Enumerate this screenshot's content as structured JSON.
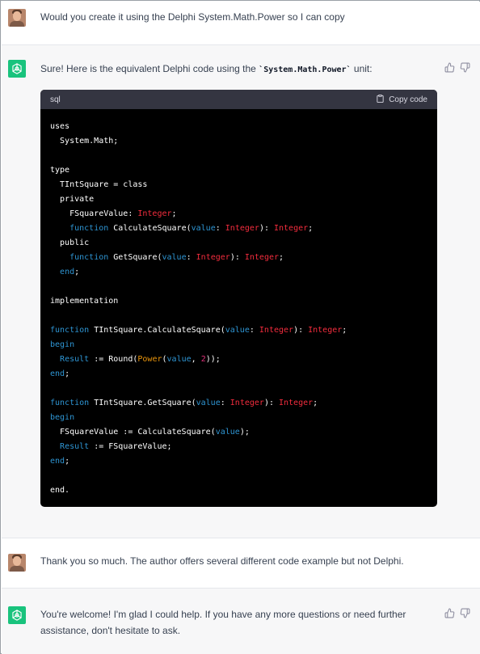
{
  "messages": [
    {
      "role": "user",
      "text": "Would you create it using the Delphi System.Math.Power so I can copy"
    },
    {
      "role": "assistant",
      "intro_before": "Sure! Here is the equivalent Delphi code using the ",
      "intro_code": "`System.Math.Power`",
      "intro_after": " unit:",
      "code": {
        "language": "sql",
        "copy_label": "Copy code",
        "lines": [
          [
            {
              "t": "uses",
              "c": "pl"
            }
          ],
          [
            {
              "t": "  System.Math;",
              "c": "pl"
            }
          ],
          [],
          [
            {
              "t": "type",
              "c": "pl"
            }
          ],
          [
            {
              "t": "  TIntSquare = class",
              "c": "pl"
            }
          ],
          [
            {
              "t": "  private",
              "c": "pl"
            }
          ],
          [
            {
              "t": "    FSquareValue: ",
              "c": "pl"
            },
            {
              "t": "Integer",
              "c": "ty"
            },
            {
              "t": ";",
              "c": "pl"
            }
          ],
          [
            {
              "t": "    ",
              "c": "pl"
            },
            {
              "t": "function",
              "c": "kw"
            },
            {
              "t": " CalculateSquare(",
              "c": "pl"
            },
            {
              "t": "value",
              "c": "kw"
            },
            {
              "t": ": ",
              "c": "pl"
            },
            {
              "t": "Integer",
              "c": "ty"
            },
            {
              "t": "): ",
              "c": "pl"
            },
            {
              "t": "Integer",
              "c": "ty"
            },
            {
              "t": ";",
              "c": "pl"
            }
          ],
          [
            {
              "t": "  public",
              "c": "pl"
            }
          ],
          [
            {
              "t": "    ",
              "c": "pl"
            },
            {
              "t": "function",
              "c": "kw"
            },
            {
              "t": " GetSquare(",
              "c": "pl"
            },
            {
              "t": "value",
              "c": "kw"
            },
            {
              "t": ": ",
              "c": "pl"
            },
            {
              "t": "Integer",
              "c": "ty"
            },
            {
              "t": "): ",
              "c": "pl"
            },
            {
              "t": "Integer",
              "c": "ty"
            },
            {
              "t": ";",
              "c": "pl"
            }
          ],
          [
            {
              "t": "  ",
              "c": "pl"
            },
            {
              "t": "end",
              "c": "kw"
            },
            {
              "t": ";",
              "c": "pl"
            }
          ],
          [],
          [
            {
              "t": "implementation",
              "c": "pl"
            }
          ],
          [],
          [
            {
              "t": "function",
              "c": "kw"
            },
            {
              "t": " TIntSquare.CalculateSquare(",
              "c": "pl"
            },
            {
              "t": "value",
              "c": "kw"
            },
            {
              "t": ": ",
              "c": "pl"
            },
            {
              "t": "Integer",
              "c": "ty"
            },
            {
              "t": "): ",
              "c": "pl"
            },
            {
              "t": "Integer",
              "c": "ty"
            },
            {
              "t": ";",
              "c": "pl"
            }
          ],
          [
            {
              "t": "begin",
              "c": "kw"
            }
          ],
          [
            {
              "t": "  ",
              "c": "pl"
            },
            {
              "t": "Result",
              "c": "kw"
            },
            {
              "t": " := Round(",
              "c": "pl"
            },
            {
              "t": "Power",
              "c": "bi"
            },
            {
              "t": "(",
              "c": "pl"
            },
            {
              "t": "value",
              "c": "kw"
            },
            {
              "t": ", ",
              "c": "pl"
            },
            {
              "t": "2",
              "c": "num"
            },
            {
              "t": "));",
              "c": "pl"
            }
          ],
          [
            {
              "t": "end",
              "c": "kw"
            },
            {
              "t": ";",
              "c": "pl"
            }
          ],
          [],
          [
            {
              "t": "function",
              "c": "kw"
            },
            {
              "t": " TIntSquare.GetSquare(",
              "c": "pl"
            },
            {
              "t": "value",
              "c": "kw"
            },
            {
              "t": ": ",
              "c": "pl"
            },
            {
              "t": "Integer",
              "c": "ty"
            },
            {
              "t": "): ",
              "c": "pl"
            },
            {
              "t": "Integer",
              "c": "ty"
            },
            {
              "t": ";",
              "c": "pl"
            }
          ],
          [
            {
              "t": "begin",
              "c": "kw"
            }
          ],
          [
            {
              "t": "  FSquareValue := CalculateSquare(",
              "c": "pl"
            },
            {
              "t": "value",
              "c": "kw"
            },
            {
              "t": ");",
              "c": "pl"
            }
          ],
          [
            {
              "t": "  ",
              "c": "pl"
            },
            {
              "t": "Result",
              "c": "kw"
            },
            {
              "t": " := FSquareValue;",
              "c": "pl"
            }
          ],
          [
            {
              "t": "end",
              "c": "kw"
            },
            {
              "t": ";",
              "c": "pl"
            }
          ],
          [],
          [
            {
              "t": "end.",
              "c": "pl"
            }
          ]
        ]
      }
    },
    {
      "role": "user",
      "text": "Thank you so much. The author offers several different code example but not Delphi."
    },
    {
      "role": "assistant",
      "text": "You're welcome! I'm glad I could help. If you have any more questions or need further assistance, don't hesitate to ask."
    }
  ],
  "icons": {
    "user_avatar": "user-avatar",
    "assistant_avatar": "openai-logo-icon",
    "thumbs_up": "thumbs-up-icon",
    "thumbs_down": "thumbs-down-icon",
    "copy": "clipboard-icon"
  },
  "colors": {
    "assistant_bg": "#f7f7f8",
    "brand_green": "#19c37d",
    "code_bg": "#000000",
    "code_header_bg": "#343541",
    "keyword": "#2e95d3",
    "type": "#f22c3d",
    "builtin": "#e9950c",
    "number": "#df3079"
  }
}
